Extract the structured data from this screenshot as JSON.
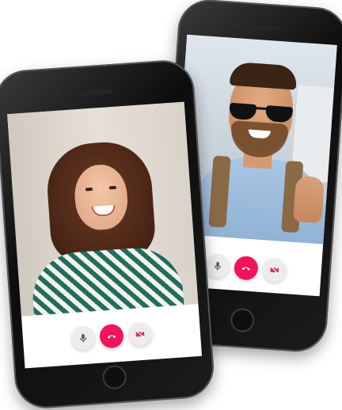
{
  "calls": [
    {
      "participant": "man",
      "controls": [
        {
          "icon": "microphone-icon"
        },
        {
          "icon": "end-call-icon",
          "color": "#f0155a"
        },
        {
          "icon": "camera-off-icon"
        }
      ]
    },
    {
      "participant": "woman",
      "controls": [
        {
          "icon": "microphone-icon"
        },
        {
          "icon": "end-call-icon",
          "color": "#f0155a"
        },
        {
          "icon": "camera-off-icon"
        }
      ]
    }
  ],
  "colors": {
    "accent": "#f0155a",
    "button_bg": "#ececec",
    "phone_body": "#111111"
  }
}
